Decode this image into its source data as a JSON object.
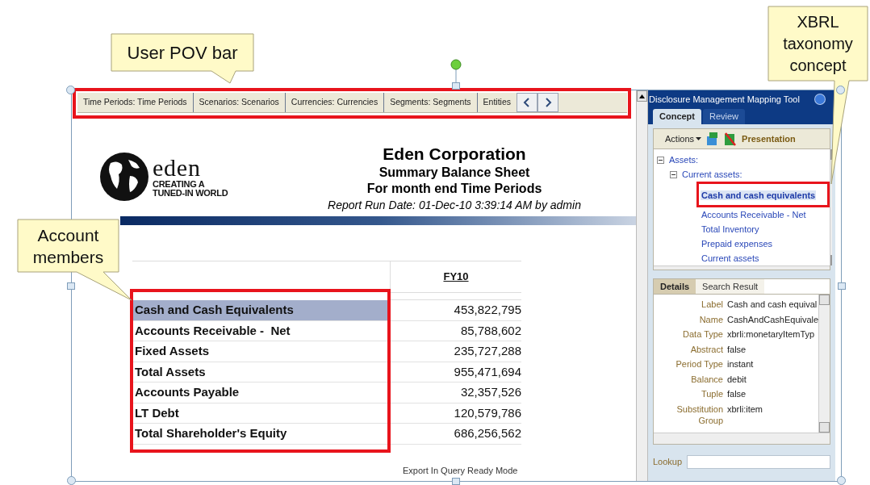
{
  "callouts": [
    {
      "text": "User POV bar"
    },
    {
      "text": "Account members"
    },
    {
      "text": "XBRL taxonomy concept"
    }
  ],
  "pov_bar": {
    "tabs": [
      "Time Periods: Time Periods",
      "Scenarios: Scenarios",
      "Currencies: Currencies",
      "Segments: Segments",
      "Entities"
    ]
  },
  "report": {
    "logo": {
      "name": "eden",
      "tagline": [
        "CREATING A",
        "TUNED-IN WORLD"
      ]
    },
    "title": "Eden Corporation",
    "subtitle": "Summary Balance Sheet",
    "period": "For month end Time Periods",
    "run_date": "Report Run Date: 01-Dec-10 3:39:14 AM by admin",
    "table": {
      "column_header": "FY10",
      "rows": [
        {
          "label": "Cash and Cash Equivalents",
          "value": "453,822,795",
          "selected": true
        },
        {
          "label": "Accounts Receivable -  Net",
          "value": "85,788,602",
          "selected": false
        },
        {
          "label": "Fixed Assets",
          "value": "235,727,288",
          "selected": false
        },
        {
          "label": "Total Assets",
          "value": "955,471,694",
          "selected": false
        },
        {
          "label": "Accounts Payable",
          "value": "32,357,526",
          "selected": false
        },
        {
          "label": "LT Debt",
          "value": "120,579,786",
          "selected": false
        },
        {
          "label": "Total Shareholder's Equity",
          "value": "686,256,562",
          "selected": false
        }
      ]
    },
    "export_link": "Export In Query Ready Mode"
  },
  "panel": {
    "title": "Disclosure Management Mapping Tool",
    "tabs": [
      {
        "label": "Concept",
        "selected": true
      },
      {
        "label": "Review",
        "selected": false
      }
    ],
    "toolbar": {
      "actions": "Actions",
      "view": "Presentation"
    },
    "tree": [
      {
        "label": "Assets:",
        "expanded": true,
        "children": [
          {
            "label": "Current assets:",
            "expanded": true,
            "children": [
              {
                "label": "Cash and cash equivalents",
                "selected": true
              },
              {
                "label": "Accounts Receivable - Net",
                "selected": false
              },
              {
                "label": "Total Inventory",
                "selected": false
              },
              {
                "label": "Prepaid expenses",
                "selected": false
              },
              {
                "label": "Current assets",
                "selected": false
              }
            ]
          }
        ]
      }
    ],
    "details_tabs": [
      {
        "label": "Details",
        "selected": true
      },
      {
        "label": "Search Result",
        "selected": false
      }
    ],
    "details": [
      {
        "label": "Label",
        "value": "Cash and cash equival"
      },
      {
        "label": "Name",
        "value": "CashAndCashEquivale"
      },
      {
        "label": "Data Type",
        "value": "xbrli:monetaryItemTyp"
      },
      {
        "label": "Abstract",
        "value": "false"
      },
      {
        "label": "Period Type",
        "value": "instant"
      },
      {
        "label": "Balance",
        "value": "debit"
      },
      {
        "label": "Tuple",
        "value": "false"
      },
      {
        "label": "Substitution Group",
        "value": "xbrli:item"
      }
    ],
    "lookup": {
      "label": "Lookup"
    }
  }
}
